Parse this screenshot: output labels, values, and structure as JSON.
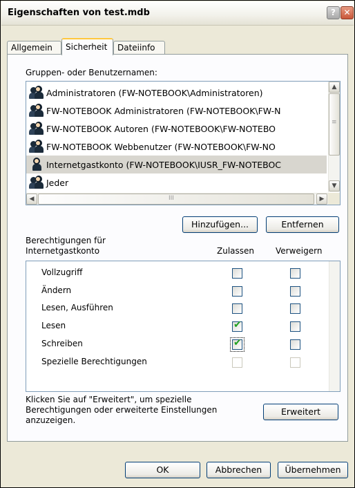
{
  "window": {
    "title": "Eigenschaften von test.mdb",
    "help_label": "?",
    "close_label": "✕"
  },
  "tabs": [
    {
      "label": "Allgemein",
      "active": false
    },
    {
      "label": "Sicherheit",
      "active": true
    },
    {
      "label": "Dateiinfo",
      "active": false
    }
  ],
  "users": {
    "label": "Gruppen- oder Benutzernamen:",
    "items": [
      {
        "name": "Administratoren (FW-NOTEBOOK\\Administratoren)",
        "icon": "group-icon",
        "selected": false
      },
      {
        "name": "FW-NOTEBOOK Administratoren (FW-NOTEBOOK\\FW-N",
        "icon": "group-icon",
        "selected": false
      },
      {
        "name": "FW-NOTEBOOK Autoren (FW-NOTEBOOK\\FW-NOTEBO",
        "icon": "group-icon",
        "selected": false
      },
      {
        "name": "FW-NOTEBOOK Webbenutzer (FW-NOTEBOOK\\FW-NO",
        "icon": "group-icon",
        "selected": false
      },
      {
        "name": "Internetgastkonto (FW-NOTEBOOK\\IUSR_FW-NOTEBOC",
        "icon": "user-icon",
        "selected": true
      },
      {
        "name": "Jeder",
        "icon": "group-icon",
        "selected": false
      }
    ],
    "scroll_up": "▲",
    "scroll_down": "▼",
    "scroll_left": "◀",
    "scroll_right": "▶",
    "grip": "≡",
    "hgrip": "III"
  },
  "buttons": {
    "add": "Hinzufügen...",
    "remove": "Entfernen",
    "advanced": "Erweitert",
    "ok": "OK",
    "cancel": "Abbrechen",
    "apply": "Übernehmen"
  },
  "permissions": {
    "label_line1": "Berechtigungen für",
    "label_line2": "Internetgastkonto",
    "allow_header": "Zulassen",
    "deny_header": "Verweigern",
    "rows": [
      {
        "label": "Vollzugriff",
        "allow": false,
        "deny": false,
        "disabled": false
      },
      {
        "label": "Ändern",
        "allow": false,
        "deny": false,
        "disabled": false
      },
      {
        "label": "Lesen, Ausführen",
        "allow": false,
        "deny": false,
        "disabled": false
      },
      {
        "label": "Lesen",
        "allow": true,
        "deny": false,
        "disabled": false
      },
      {
        "label": "Schreiben",
        "allow": true,
        "deny": false,
        "disabled": false,
        "focused": true
      },
      {
        "label": "Spezielle Berechtigungen",
        "allow": false,
        "deny": false,
        "disabled": true
      }
    ]
  },
  "advanced_hint": {
    "line1": "Klicken Sie auf \"Erweitert\", um spezielle",
    "line2": "Berechtigungen oder erweiterte Einstellungen",
    "line3": "anzuzeigen."
  }
}
